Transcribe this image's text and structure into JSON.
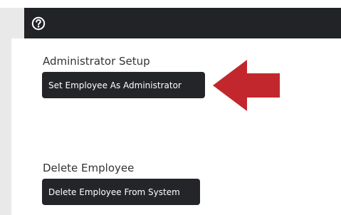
{
  "header": {
    "help_icon": "question-circle-icon",
    "bar_color": "#222326"
  },
  "admin_section": {
    "title": "Administrator Setup",
    "button_label": "Set Employee As Administrator"
  },
  "delete_section": {
    "title": "Delete Employee",
    "button_label": "Delete Employee From System"
  },
  "annotation": {
    "arrow_icon": "left-arrow-icon",
    "arrow_color": "#c1272d"
  }
}
